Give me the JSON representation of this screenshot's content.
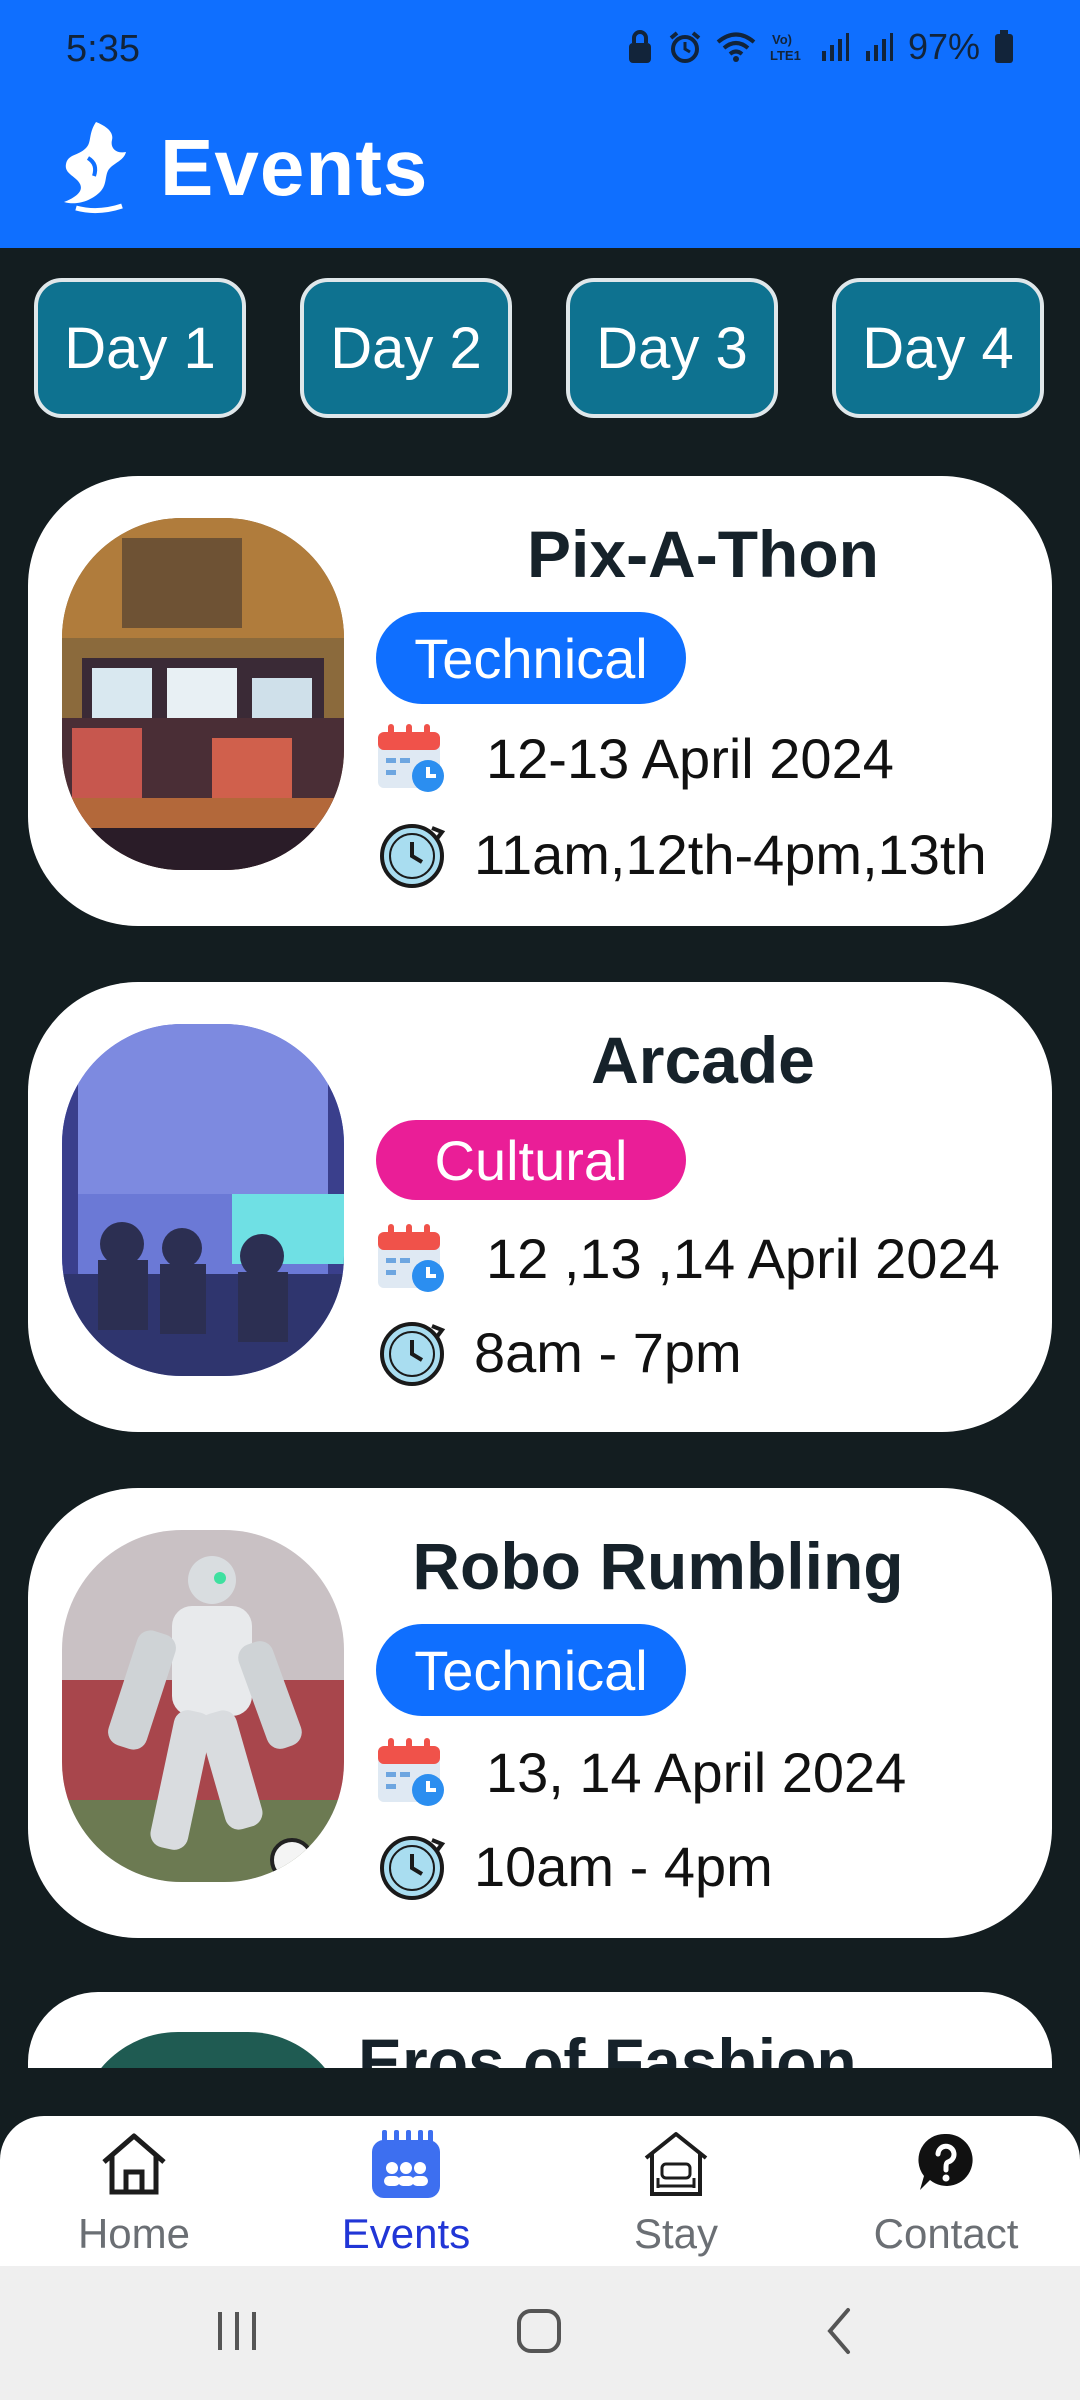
{
  "status_bar": {
    "time": "5:35",
    "battery": "97%",
    "icons": [
      "lock-icon",
      "alarm-icon",
      "wifi-icon",
      "volte-icon",
      "signal-icon",
      "signal-icon",
      "battery-icon"
    ]
  },
  "app_bar": {
    "title": "Events",
    "logo": "sport-crest-logo"
  },
  "day_tabs": [
    {
      "label": "Day 1"
    },
    {
      "label": "Day 2"
    },
    {
      "label": "Day 3"
    },
    {
      "label": "Day 4"
    }
  ],
  "events": [
    {
      "title": "Pix-A-Thon",
      "category": "Technical",
      "category_color": "#0f6fff",
      "date": "12-13 April 2024",
      "time": "11am,12th-4pm,13th",
      "image": "pixel-art-computer-lab"
    },
    {
      "title": "Arcade",
      "category": "Cultural",
      "category_color": "#ea1e97",
      "date": "12 ,13 ,14 April 2024",
      "time": "8am - 7pm",
      "image": "gamers-at-screens"
    },
    {
      "title": "Robo Rumbling",
      "category": "Technical",
      "category_color": "#0f6fff",
      "date": "13, 14 April 2024",
      "time": "10am - 4pm",
      "image": "robot-football"
    },
    {
      "title": "Eros of Fashion"
    }
  ],
  "bottom_nav": [
    {
      "label": "Home",
      "icon": "home-icon",
      "active": false
    },
    {
      "label": "Events",
      "icon": "events-icon",
      "active": true,
      "color": "#2136d6"
    },
    {
      "label": "Stay",
      "icon": "stay-icon",
      "active": false
    },
    {
      "label": "Contact",
      "icon": "help-icon",
      "active": false
    }
  ],
  "system_nav": [
    "recents-button",
    "home-button",
    "back-button"
  ]
}
